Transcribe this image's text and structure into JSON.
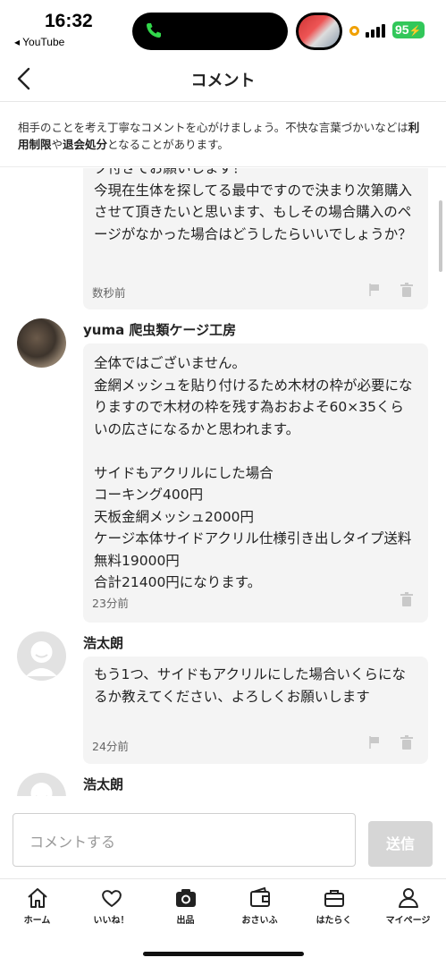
{
  "status": {
    "time": "16:32",
    "back_app": "◂ YouTube",
    "battery": "95"
  },
  "header": {
    "title": "コメント"
  },
  "notice": {
    "part1": "相手のことを考え丁寧なコメントを心がけましょう。不快な言葉づかいなどは",
    "bold1": "利用制限",
    "part2": "や",
    "bold2": "退会処分",
    "part3": "となることがあります。"
  },
  "comments": [
    {
      "text": "ク付きでお願いします！\n今現在生体を探してる最中ですので決まり次第購入させて頂きたいと思います、もしその場合購入のページがなかった場合はどうしたらいいでしょうか？",
      "time": "数秒前"
    },
    {
      "user": "yuma 爬虫類ケージ工房",
      "text": "全体ではございません。\n金網メッシュを貼り付けるため木材の枠が必要になりますので木材の枠を残す為おおよそ60×35くらいの広さになるかと思われます。\n\nサイドもアクリルにした場合\nコーキング400円\n天板金網メッシュ2000円\nケージ本体サイドアクリル仕様引き出しタイプ送料無料19000円\n合計21400円になります。",
      "time": "23分前"
    },
    {
      "user": "浩太朗",
      "text": "もう1つ、サイドもアクリルにした場合いくらになるか教えてください、よろしくお願いします",
      "time": "24分前"
    },
    {
      "user": "浩太朗"
    }
  ],
  "input": {
    "placeholder": "コメントする",
    "send_label": "送信"
  },
  "tabs": [
    {
      "label": "ホーム",
      "icon": "home-icon"
    },
    {
      "label": "いいね！",
      "icon": "heart-icon"
    },
    {
      "label": "出品",
      "icon": "camera-icon"
    },
    {
      "label": "おさいふ",
      "icon": "wallet-icon"
    },
    {
      "label": "はたらく",
      "icon": "briefcase-icon"
    },
    {
      "label": "マイページ",
      "icon": "person-icon"
    }
  ]
}
